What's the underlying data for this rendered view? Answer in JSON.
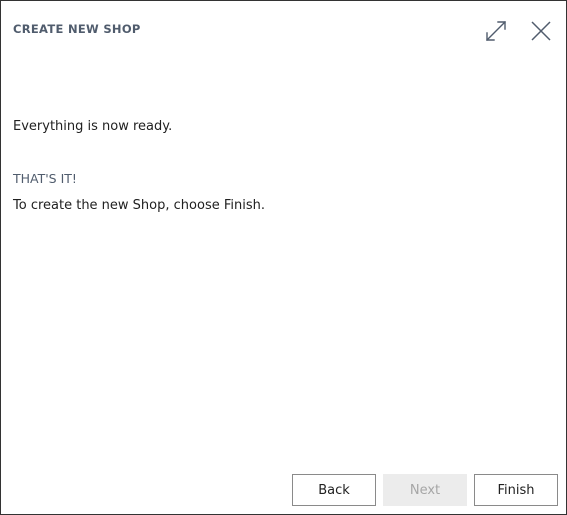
{
  "dialog": {
    "title": "CREATE NEW SHOP",
    "message": "Everything is now ready.",
    "heading": "THAT'S IT!",
    "instruction": "To create the new Shop, choose Finish."
  },
  "buttons": {
    "back": "Back",
    "next": "Next",
    "finish": "Finish"
  },
  "state": {
    "next_disabled": true
  },
  "icons": {
    "expand": "expand-icon",
    "close": "close-icon"
  },
  "colors": {
    "title_text": "#505c6d",
    "body_text": "#212121",
    "disabled_bg": "#ececec",
    "disabled_text": "#a6a6a6",
    "border": "#333333"
  }
}
